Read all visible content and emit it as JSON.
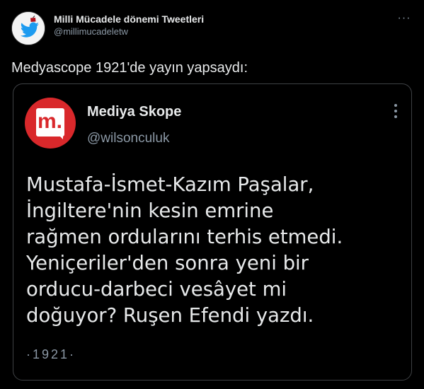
{
  "outer_tweet": {
    "author_name": "Milli Mücadele dönemi Tweetleri",
    "author_handle": "@millimucadeletw",
    "avatar_icon": "twitter-bird-with-fez-icon",
    "more_icon": "more-horizontal-icon",
    "more_glyph": "···",
    "text": "Medyascope 1921'de yayın yapsaydı:"
  },
  "quoted_tweet": {
    "avatar_icon": "mediyaskope-m-logo-icon",
    "logo_letter": "m.",
    "author_name": "Mediya Skope",
    "author_handle": "@wilsonculuk",
    "more_icon": "more-vertical-icon",
    "text_lines": [
      "Mustafa-İsmet-Kazım Paşalar,",
      "İngiltere'nin kesin emrine",
      "rağmen ordularını terhis etmedi.",
      "Yeniçeriler'den sonra yeni bir",
      "orducu-darbeci vesâyet mi",
      "doğuyor? Ruşen Efendi yazdı."
    ],
    "footer": "·1921·"
  },
  "colors": {
    "background": "#000000",
    "primary_text": "#e7e9ea",
    "secondary_text": "#8b98a5",
    "twitter_blue": "#1d9bf0",
    "brand_red": "#d9282b"
  }
}
